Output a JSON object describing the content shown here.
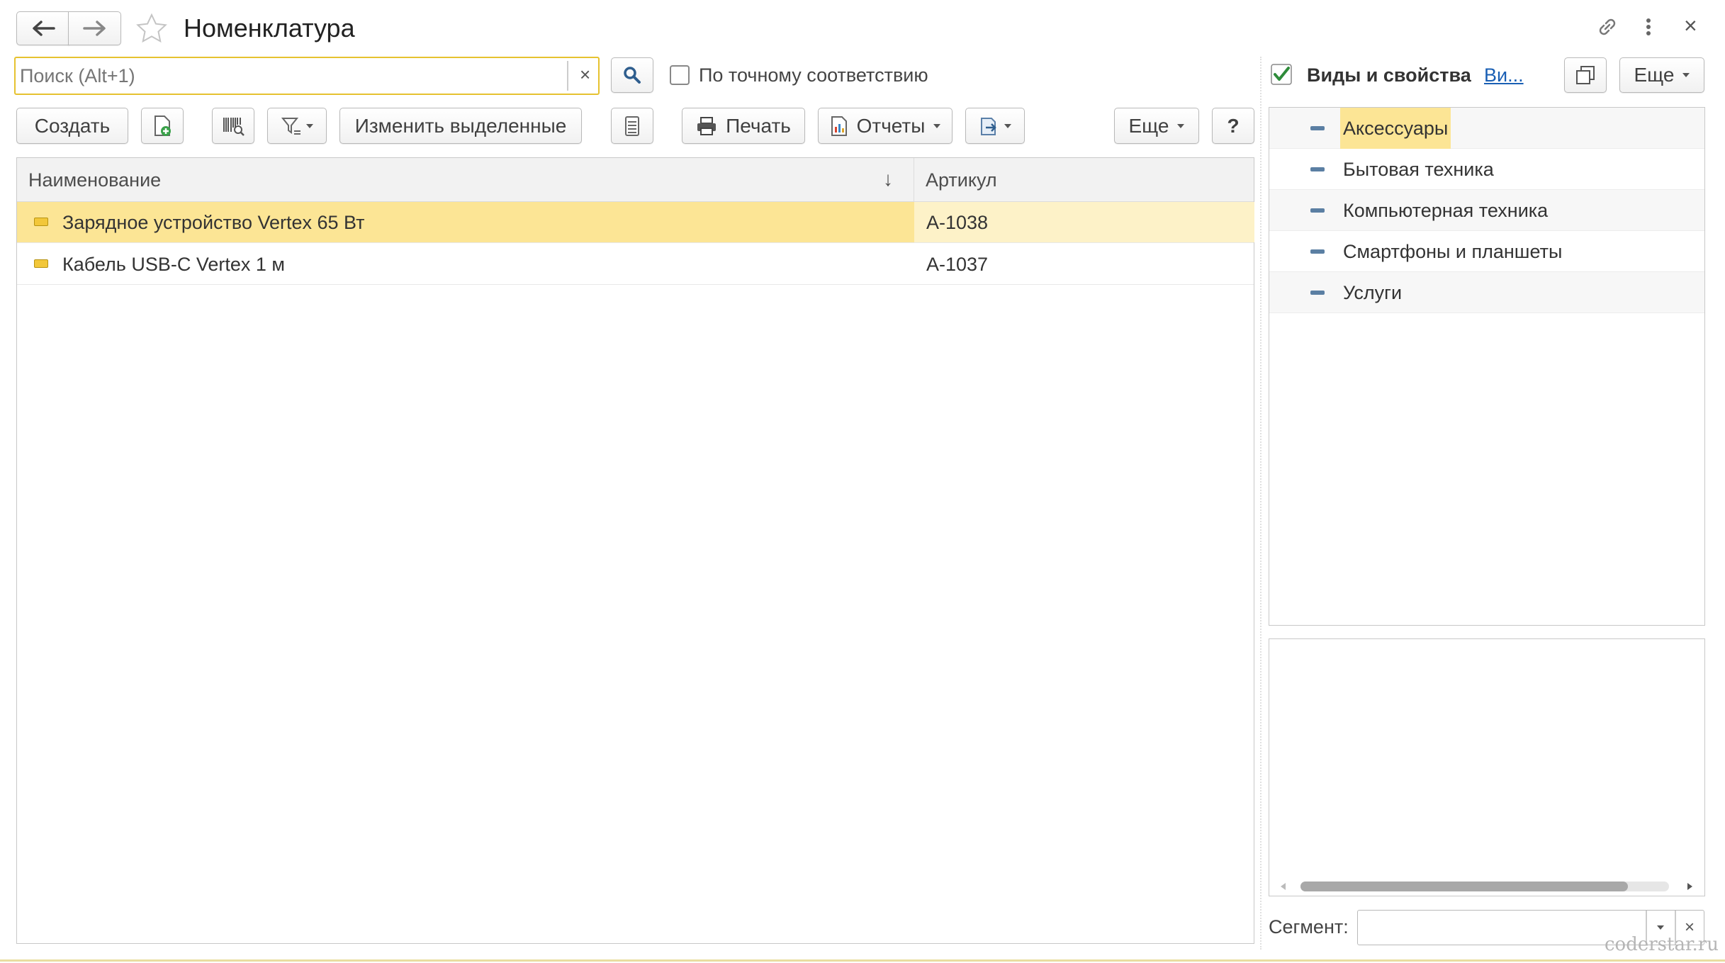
{
  "window": {
    "title": "Номенклатура",
    "nav_back_icon": "arrow-left-icon",
    "nav_forward_icon": "arrow-right-icon",
    "favorite_icon": "star-icon",
    "link_icon": "link-icon",
    "more_icon": "vertical-dots-icon",
    "close_label": "×"
  },
  "search": {
    "placeholder": "Поиск (Alt+1)",
    "value": "",
    "clear_label": "×",
    "exact_match_label": "По точному соответствию",
    "exact_match_checked": false
  },
  "toolbar": {
    "create_label": "Создать",
    "change_selected_label": "Изменить выделенные",
    "print_label": "Печать",
    "reports_label": "Отчеты",
    "more_label": "Еще",
    "help_label": "?"
  },
  "table": {
    "columns": [
      "Наименование",
      "Артикул"
    ],
    "sort_indicator": "↓",
    "rows": [
      {
        "name": "Зарядное устройство Vertex 65 Вт",
        "article": "А-1038",
        "selected": true
      },
      {
        "name": "Кабель USB-C Vertex 1 м",
        "article": "А-1037",
        "selected": false
      }
    ]
  },
  "side_panel": {
    "types_checked": true,
    "types_label": "Виды и свойства",
    "types_link": "Ви...",
    "more_label": "Еще",
    "tree_items": [
      {
        "label": "Аксессуары",
        "selected": true
      },
      {
        "label": "Бытовая техника",
        "selected": false
      },
      {
        "label": "Компьютерная техника",
        "selected": false
      },
      {
        "label": "Смартфоны и планшеты",
        "selected": false
      },
      {
        "label": "Услуги",
        "selected": false
      }
    ],
    "segment_label": "Сегмент:",
    "segment_value": "",
    "segment_clear_label": "×"
  },
  "watermark": "coderstar.ru",
  "colors": {
    "selected_row": "#fce595",
    "selected_row_secondary": "#fdf2c8",
    "search_border": "#e6c230",
    "link": "#1a5fb4",
    "check": "#2e8b3a"
  }
}
